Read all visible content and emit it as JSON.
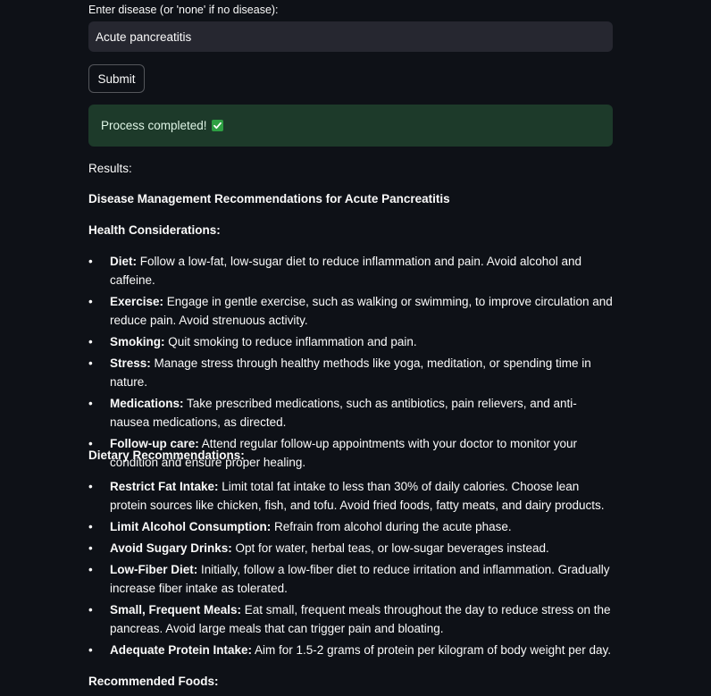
{
  "form": {
    "label": "Enter disease (or 'none' if no disease):",
    "input_value": "Acute pancreatitis",
    "submit_label": "Submit"
  },
  "status": {
    "message": "Process completed!",
    "icon": "check-mark-button-icon",
    "color": "#1d3a2a"
  },
  "results": {
    "label": "Results:",
    "title": "Disease Management Recommendations for Acute Pancreatitis",
    "health_heading": "Health Considerations:",
    "health_items": [
      {
        "term": "Diet:",
        "text": " Follow a low-fat, low-sugar diet to reduce inflammation and pain. Avoid alcohol and caffeine."
      },
      {
        "term": "Exercise:",
        "text": " Engage in gentle exercise, such as walking or swimming, to improve circulation and reduce pain. Avoid strenuous activity."
      },
      {
        "term": "Smoking:",
        "text": " Quit smoking to reduce inflammation and pain."
      },
      {
        "term": "Stress:",
        "text": " Manage stress through healthy methods like yoga, meditation, or spending time in nature."
      },
      {
        "term": "Medications:",
        "text": " Take prescribed medications, such as antibiotics, pain relievers, and anti-nausea medications, as directed."
      },
      {
        "term": "Follow-up care:",
        "text": " Attend regular follow-up appointments with your doctor to monitor your condition and ensure proper healing."
      }
    ],
    "dietary_heading": "Dietary Recommendations:",
    "dietary_items": [
      {
        "term": "Restrict Fat Intake:",
        "text": " Limit total fat intake to less than 30% of daily calories. Choose lean protein sources like chicken, fish, and tofu. Avoid fried foods, fatty meats, and dairy products."
      },
      {
        "term": "Limit Alcohol Consumption:",
        "text": " Refrain from alcohol during the acute phase."
      },
      {
        "term": "Avoid Sugary Drinks:",
        "text": " Opt for water, herbal teas, or low-sugar beverages instead."
      },
      {
        "term": "Low-Fiber Diet:",
        "text": " Initially, follow a low-fiber diet to reduce irritation and inflammation. Gradually increase fiber intake as tolerated."
      },
      {
        "term": "Small, Frequent Meals:",
        "text": " Eat small, frequent meals throughout the day to reduce stress on the pancreas. Avoid large meals that can trigger pain and bloating."
      },
      {
        "term": "Adequate Protein Intake:",
        "text": " Aim for 1.5-2 grams of protein per kilogram of body weight per day."
      }
    ],
    "foods_heading": "Recommended Foods:"
  }
}
